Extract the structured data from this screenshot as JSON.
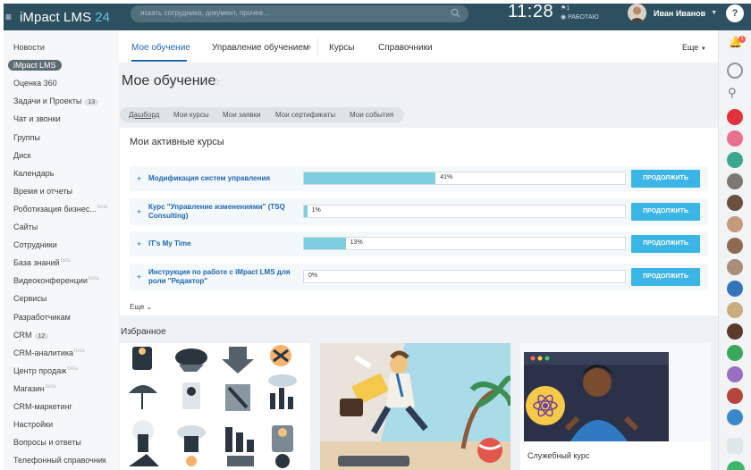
{
  "header": {
    "logo_main": "iMpact LMS",
    "logo_num": "24",
    "search_placeholder": "искать сотрудника, документ, прочее...",
    "time": "11:28",
    "status_flag": "1",
    "status_text": "РАБОТАЮ",
    "user_name": "Иван Иванов"
  },
  "sidebar": {
    "items": [
      {
        "label": "Новости"
      },
      {
        "label": "iMpact LMS",
        "active": true
      },
      {
        "label": "Оценка 360"
      },
      {
        "label": "Задачи и Проекты",
        "count": "13"
      },
      {
        "label": "Чат и звонки"
      },
      {
        "label": "Группы"
      },
      {
        "label": "Диск"
      },
      {
        "label": "Календарь"
      },
      {
        "label": "Время и отчеты"
      },
      {
        "label": "Роботизация бизнес...",
        "beta": "beta"
      },
      {
        "label": "Сайты"
      },
      {
        "label": "Сотрудники"
      },
      {
        "label": "База знаний",
        "beta": "beta"
      },
      {
        "label": "Видеоконференции",
        "beta": "beta"
      },
      {
        "label": "Сервисы"
      },
      {
        "label": "Разработчикам"
      },
      {
        "label": "CRM",
        "count": "12"
      },
      {
        "label": "CRM-аналитика",
        "beta": "beta"
      },
      {
        "label": "Центр продаж",
        "beta": "beta"
      },
      {
        "label": "Магазин",
        "beta": "beta"
      },
      {
        "label": "CRM-маркетинг"
      },
      {
        "label": "Настройки"
      },
      {
        "label": "Вопросы и ответы"
      },
      {
        "label": "Телефонный справочник"
      }
    ]
  },
  "tabs": {
    "my_learning": "Мое обучение",
    "management": "Управление обучением",
    "courses": "Курсы",
    "references": "Справочники",
    "more": "Еще"
  },
  "page": {
    "title": "Мое обучение"
  },
  "subtabs": [
    "Дашборд",
    "Мои курсы",
    "Мои заявки",
    "Мои сертификаты",
    "Мои события"
  ],
  "courses": {
    "title": "Мои активные курсы",
    "continue_label": "ПРОДОЛЖИТЬ",
    "more": "Еще",
    "items": [
      {
        "name": "Модификация систем управления",
        "progress": 41,
        "progress_label": "41%"
      },
      {
        "name": "Курс \"Управление изменениями\" (TSQ Consulting)",
        "progress": 1,
        "progress_label": "1%"
      },
      {
        "name": "IT's My Time",
        "progress": 13,
        "progress_label": "13%"
      },
      {
        "name": "Инструкция по работе с iMpact LMS для роли \"Редактор\"",
        "progress": 0,
        "progress_label": "0%"
      }
    ]
  },
  "favorites": {
    "title": "Избранное",
    "card3_label": "Служебный курс"
  },
  "colors": {
    "header_bg": "#2c5060",
    "accent": "#2067b0",
    "button": "#3bb5e6",
    "progress": "#7dcfe0"
  }
}
